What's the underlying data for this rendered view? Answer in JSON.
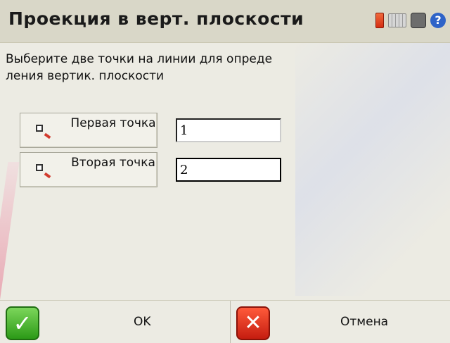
{
  "title_bar": {
    "title": "Проекция в верт. плоскости",
    "icons": [
      "battery-icon",
      "keyboard-icon",
      "settings-icon",
      "help-icon"
    ],
    "help_glyph": "?"
  },
  "instruction": "Выберите две точки на линии для определения вертик. плоскости",
  "points": [
    {
      "button_label": "Первая точка",
      "value": "1"
    },
    {
      "button_label": "Вторая точка",
      "value": "2"
    }
  ],
  "buttons": {
    "ok": "OK",
    "cancel": "Отмена",
    "ok_glyph": "✓",
    "cancel_glyph": "✕"
  },
  "colors": {
    "background": "#ecebe3",
    "title_bar": "#d9d7c8",
    "ok_green": "#2c9a17",
    "cancel_red": "#c51d10"
  }
}
